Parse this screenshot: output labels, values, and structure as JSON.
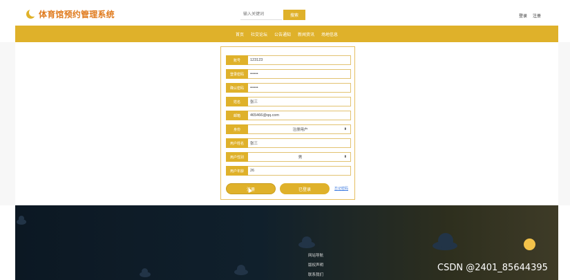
{
  "header": {
    "site_title": "体育馆预约管理系统",
    "search_placeholder": "输入关键词",
    "search_button": "搜索",
    "login_link": "登录",
    "register_link": "注册"
  },
  "nav": {
    "items": [
      "首页",
      "社交论坛",
      "公告通知",
      "新闻资讯",
      "场地信息"
    ]
  },
  "form": {
    "fields": [
      {
        "label": "账号",
        "value": "123123"
      },
      {
        "label": "登录密码",
        "value": "••••••"
      },
      {
        "label": "确认密码",
        "value": "••••••"
      },
      {
        "label": "姓名",
        "value": "张三"
      },
      {
        "label": "邮箱",
        "value": "465466@qq.com"
      },
      {
        "label": "身份",
        "value": "注册用户"
      },
      {
        "label": "用户姓名",
        "value": "张三"
      },
      {
        "label": "用户性别",
        "value": "男"
      },
      {
        "label": "用户年龄",
        "value": "26"
      }
    ],
    "register_button": "注册",
    "login_button": "已登录",
    "forgot_link": "忘记密码"
  },
  "footer": {
    "links": [
      "网站导航",
      "版权声明",
      "联系我们"
    ]
  },
  "watermark": "CSDN @2401_85644395",
  "colors": {
    "accent": "#dfb12a",
    "title": "#e07b1e",
    "footer_dark": "#0c1823"
  }
}
